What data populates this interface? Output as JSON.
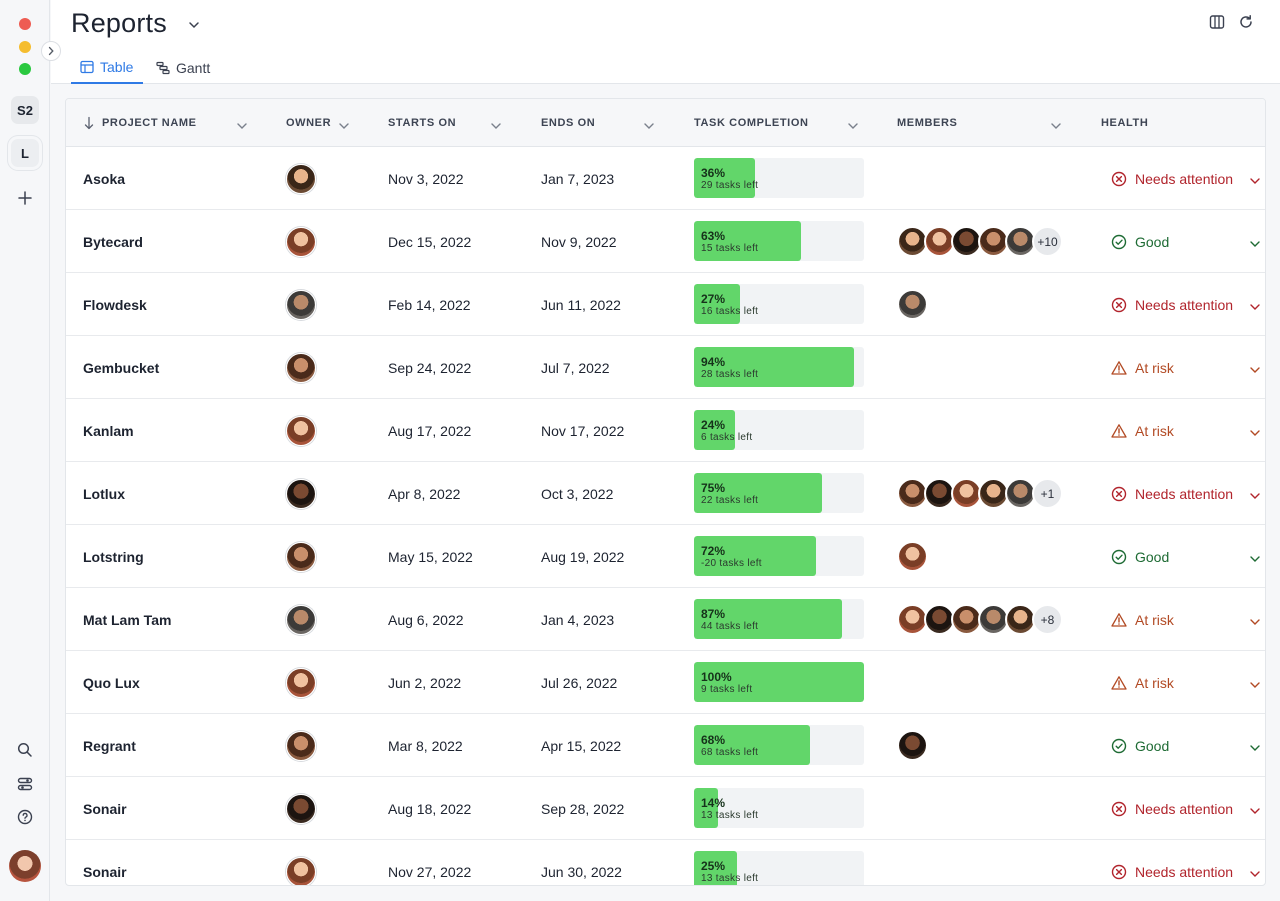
{
  "rail": {
    "workspaces": [
      {
        "label": "S2"
      },
      {
        "label": "L"
      }
    ]
  },
  "header": {
    "title": "Reports",
    "tabs": [
      {
        "label": "Table",
        "active": true
      },
      {
        "label": "Gantt",
        "active": false
      }
    ]
  },
  "table": {
    "columns": [
      "PROJECT NAME",
      "OWNER",
      "STARTS ON",
      "ENDS ON",
      "TASK COMPLETION",
      "MEMBERS",
      "HEALTH"
    ],
    "rows": [
      {
        "name": "Asoka",
        "starts": "Nov 3, 2022",
        "ends": "Jan 7, 2023",
        "pct": "36%",
        "progress": 0.36,
        "left": "29 tasks left",
        "members": [],
        "more": "",
        "health": "Needs attention",
        "status": "bad"
      },
      {
        "name": "Bytecard",
        "starts": "Dec 15, 2022",
        "ends": "Nov 9, 2022",
        "pct": "63%",
        "progress": 0.63,
        "left": "15 tasks left",
        "members": [
          "a",
          "b",
          "c",
          "d",
          "e"
        ],
        "more": "+10",
        "health": "Good",
        "status": "good"
      },
      {
        "name": "Flowdesk",
        "starts": "Feb 14, 2022",
        "ends": "Jun 11, 2022",
        "pct": "27%",
        "progress": 0.27,
        "left": "16 tasks left",
        "members": [
          "e"
        ],
        "more": "",
        "health": "Needs attention",
        "status": "bad"
      },
      {
        "name": "Gembucket",
        "starts": "Sep 24, 2022",
        "ends": "Jul 7, 2022",
        "pct": "94%",
        "progress": 0.94,
        "left": "28 tasks left",
        "members": [],
        "more": "",
        "health": "At risk",
        "status": "warn"
      },
      {
        "name": "Kanlam",
        "starts": "Aug 17, 2022",
        "ends": "Nov 17, 2022",
        "pct": "24%",
        "progress": 0.24,
        "left": "6 tasks left",
        "members": [],
        "more": "",
        "health": "At risk",
        "status": "warn"
      },
      {
        "name": "Lotlux",
        "starts": "Apr 8, 2022",
        "ends": "Oct 3, 2022",
        "pct": "75%",
        "progress": 0.75,
        "left": "22 tasks left",
        "members": [
          "d",
          "c",
          "b",
          "a",
          "e"
        ],
        "more": "+1",
        "health": "Needs attention",
        "status": "bad"
      },
      {
        "name": "Lotstring",
        "starts": "May 15, 2022",
        "ends": "Aug 19, 2022",
        "pct": "72%",
        "progress": 0.72,
        "left": "-20 tasks left",
        "members": [
          "b"
        ],
        "more": "",
        "health": "Good",
        "status": "good"
      },
      {
        "name": "Mat Lam Tam",
        "starts": "Aug 6, 2022",
        "ends": "Jan 4, 2023",
        "pct": "87%",
        "progress": 0.87,
        "left": "44 tasks left",
        "members": [
          "b",
          "c",
          "d",
          "e",
          "a"
        ],
        "more": "+8",
        "health": "At risk",
        "status": "warn"
      },
      {
        "name": "Quo Lux",
        "starts": "Jun 2, 2022",
        "ends": "Jul 26, 2022",
        "pct": "100%",
        "progress": 1.0,
        "left": "9 tasks left",
        "members": [],
        "more": "",
        "health": "At risk",
        "status": "warn"
      },
      {
        "name": "Regrant",
        "starts": "Mar 8, 2022",
        "ends": "Apr 15, 2022",
        "pct": "68%",
        "progress": 0.68,
        "left": "68 tasks left",
        "members": [
          "c"
        ],
        "more": "",
        "health": "Good",
        "status": "good"
      },
      {
        "name": "Sonair",
        "starts": "Aug 18, 2022",
        "ends": "Sep 28, 2022",
        "pct": "14%",
        "progress": 0.14,
        "left": "13 tasks left",
        "members": [],
        "more": "",
        "health": "Needs attention",
        "status": "bad"
      },
      {
        "name": "Sonair",
        "starts": "Nov 27, 2022",
        "ends": "Jun 30, 2022",
        "pct": "25%",
        "progress": 0.25,
        "left": "13 tasks left",
        "members": [],
        "more": "",
        "health": "Needs attention",
        "status": "bad"
      }
    ]
  },
  "colors": {
    "accent": "#2f7ae5",
    "progress": "#62d66a",
    "bad": "#b1242c",
    "warn": "#b24a24",
    "good": "#1e6b34"
  }
}
